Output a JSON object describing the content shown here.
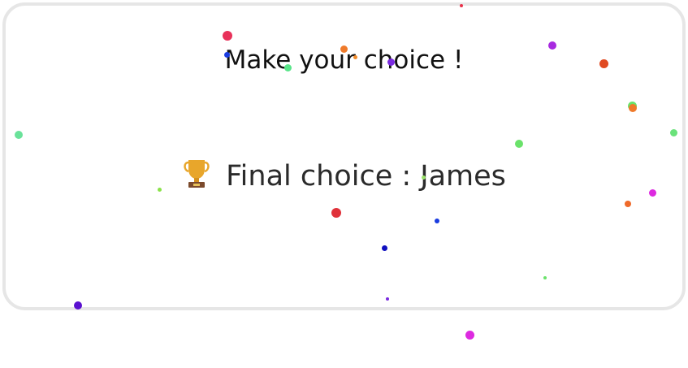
{
  "heading": "Make your choice !",
  "result": {
    "icon": "trophy-icon",
    "label": "Final choice : James"
  },
  "colors": {
    "card_border": "#e6e6e6",
    "text": "#2b2b2b"
  }
}
